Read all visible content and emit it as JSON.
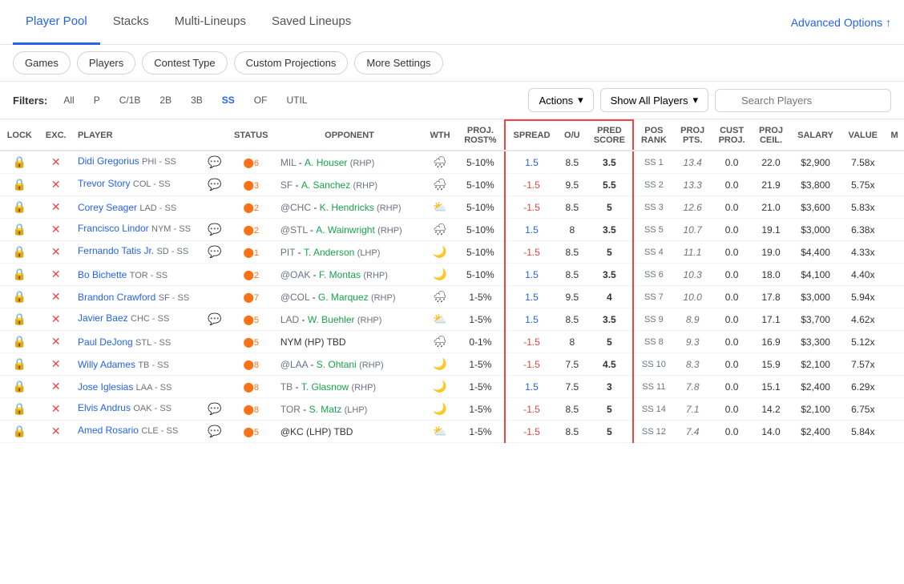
{
  "nav": {
    "links": [
      {
        "id": "player-pool",
        "label": "Player Pool",
        "active": true
      },
      {
        "id": "stacks",
        "label": "Stacks",
        "active": false
      },
      {
        "id": "multi-lineups",
        "label": "Multi-Lineups",
        "active": false
      },
      {
        "id": "saved-lineups",
        "label": "Saved Lineups",
        "active": false
      }
    ],
    "advanced_options": "Advanced Options ↑"
  },
  "filter_bar": {
    "buttons": [
      "Games",
      "Players",
      "Contest Type",
      "Custom Projections",
      "More Settings"
    ]
  },
  "table_controls": {
    "filters_label": "Filters:",
    "filter_tags": [
      "All",
      "P",
      "C/1B",
      "2B",
      "3B",
      "SS",
      "OF",
      "UTIL"
    ],
    "active_filter": "SS",
    "actions_label": "Actions",
    "show_players_label": "Show All Players",
    "search_placeholder": "Search Players"
  },
  "table": {
    "headers": [
      "LOCK",
      "EXC.",
      "PLAYER",
      "STATUS",
      "OPPONENT",
      "WTH",
      "PROJ. ROST%",
      "SPREAD",
      "O/U",
      "PRED SCORE",
      "POS RANK",
      "PROJ PTS.",
      "CUST PROJ.",
      "PROJ CEIL.",
      "SALARY",
      "VALUE",
      "M"
    ],
    "rows": [
      {
        "lock": true,
        "exc": true,
        "player": "Didi Gregorius",
        "team": "PHI",
        "pos": "SS",
        "status_num": "6",
        "opponent": "MIL - A. Houser",
        "opp_type": "RHP",
        "wth": "rain",
        "proj_rost": "5-10%",
        "spread": "1.5",
        "spread_pos": true,
        "ou": "8.5",
        "pred_score": "3.5",
        "pos_rank": "SS 1",
        "proj_pts": "13.4",
        "cust_proj": "0.0",
        "proj_ceil": "22.0",
        "salary": "$2,900",
        "value": "7.58x",
        "msg": true
      },
      {
        "lock": true,
        "exc": true,
        "player": "Trevor Story",
        "team": "COL",
        "pos": "SS",
        "status_num": "3",
        "opponent": "SF - A. Sanchez",
        "opp_type": "RHP",
        "wth": "rain",
        "proj_rost": "5-10%",
        "spread": "-1.5",
        "spread_pos": false,
        "ou": "9.5",
        "pred_score": "5.5",
        "pos_rank": "SS 2",
        "proj_pts": "13.3",
        "cust_proj": "0.0",
        "proj_ceil": "21.9",
        "salary": "$3,800",
        "value": "5.75x",
        "msg": true
      },
      {
        "lock": true,
        "exc": true,
        "player": "Corey Seager",
        "team": "LAD",
        "pos": "SS",
        "status_num": "2",
        "opponent": "@CHC - K. Hendricks",
        "opp_type": "RHP",
        "wth": "cloud",
        "proj_rost": "5-10%",
        "spread": "-1.5",
        "spread_pos": false,
        "ou": "8.5",
        "pred_score": "5",
        "pos_rank": "SS 3",
        "proj_pts": "12.6",
        "cust_proj": "0.0",
        "proj_ceil": "21.0",
        "salary": "$3,600",
        "value": "5.83x",
        "msg": false
      },
      {
        "lock": true,
        "exc": true,
        "player": "Francisco Lindor",
        "team": "NYM",
        "pos": "SS",
        "status_num": "2",
        "opponent": "@STL - A. Wainwright",
        "opp_type": "RHP",
        "wth": "rain",
        "proj_rost": "5-10%",
        "spread": "1.5",
        "spread_pos": true,
        "ou": "8",
        "pred_score": "3.5",
        "pos_rank": "SS 5",
        "proj_pts": "10.7",
        "cust_proj": "0.0",
        "proj_ceil": "19.1",
        "salary": "$3,000",
        "value": "6.38x",
        "msg": true
      },
      {
        "lock": true,
        "exc": true,
        "player": "Fernando Tatis Jr.",
        "team": "SD",
        "pos": "SS",
        "status_num": "1",
        "opponent": "PIT - T. Anderson",
        "opp_type": "LHP",
        "wth": "moon",
        "proj_rost": "5-10%",
        "spread": "-1.5",
        "spread_pos": false,
        "ou": "8.5",
        "pred_score": "5",
        "pos_rank": "SS 4",
        "proj_pts": "11.1",
        "cust_proj": "0.0",
        "proj_ceil": "19.0",
        "salary": "$4,400",
        "value": "4.33x",
        "msg": true
      },
      {
        "lock": true,
        "exc": true,
        "player": "Bo Bichette",
        "team": "TOR",
        "pos": "SS",
        "status_num": "2",
        "opponent": "@OAK - F. Montas",
        "opp_type": "RHP",
        "wth": "moon",
        "proj_rost": "5-10%",
        "spread": "1.5",
        "spread_pos": true,
        "ou": "8.5",
        "pred_score": "3.5",
        "pos_rank": "SS 6",
        "proj_pts": "10.3",
        "cust_proj": "0.0",
        "proj_ceil": "18.0",
        "salary": "$4,100",
        "value": "4.40x",
        "msg": false
      },
      {
        "lock": true,
        "exc": true,
        "player": "Brandon Crawford",
        "team": "SF",
        "pos": "SS",
        "status_num": "7",
        "opponent": "@COL - G. Marquez",
        "opp_type": "RHP",
        "wth": "rain",
        "proj_rost": "1-5%",
        "spread": "1.5",
        "spread_pos": true,
        "ou": "9.5",
        "pred_score": "4",
        "pos_rank": "SS 7",
        "proj_pts": "10.0",
        "cust_proj": "0.0",
        "proj_ceil": "17.8",
        "salary": "$3,000",
        "value": "5.94x",
        "msg": false
      },
      {
        "lock": true,
        "exc": true,
        "player": "Javier Baez",
        "team": "CHC",
        "pos": "SS",
        "status_num": "5",
        "opponent": "LAD - W. Buehler",
        "opp_type": "RHP",
        "wth": "cloud",
        "proj_rost": "1-5%",
        "spread": "1.5",
        "spread_pos": true,
        "ou": "8.5",
        "pred_score": "3.5",
        "pos_rank": "SS 9",
        "proj_pts": "8.9",
        "cust_proj": "0.0",
        "proj_ceil": "17.1",
        "salary": "$3,700",
        "value": "4.62x",
        "msg": true
      },
      {
        "lock": true,
        "exc": true,
        "player": "Paul DeJong",
        "team": "STL",
        "pos": "SS",
        "status_num": "5",
        "opponent": "NYM (HP) TBD",
        "opp_type": "",
        "wth": "rain",
        "proj_rost": "0-1%",
        "spread": "-1.5",
        "spread_pos": false,
        "ou": "8",
        "pred_score": "5",
        "pos_rank": "SS 8",
        "proj_pts": "9.3",
        "cust_proj": "0.0",
        "proj_ceil": "16.9",
        "salary": "$3,300",
        "value": "5.12x",
        "msg": false
      },
      {
        "lock": true,
        "exc": true,
        "player": "Willy Adames",
        "team": "TB",
        "pos": "SS",
        "status_num": "8",
        "opponent": "@LAA - S. Ohtani",
        "opp_type": "RHP",
        "wth": "moon",
        "proj_rost": "1-5%",
        "spread": "-1.5",
        "spread_pos": false,
        "ou": "7.5",
        "pred_score": "4.5",
        "pos_rank": "SS 10",
        "proj_pts": "8.3",
        "cust_proj": "0.0",
        "proj_ceil": "15.9",
        "salary": "$2,100",
        "value": "7.57x",
        "msg": false
      },
      {
        "lock": true,
        "exc": true,
        "player": "Jose Iglesias",
        "team": "LAA",
        "pos": "SS",
        "status_num": "8",
        "opponent": "TB - T. Glasnow",
        "opp_type": "RHP",
        "wth": "moon",
        "proj_rost": "1-5%",
        "spread": "1.5",
        "spread_pos": true,
        "ou": "7.5",
        "pred_score": "3",
        "pos_rank": "SS 11",
        "proj_pts": "7.8",
        "cust_proj": "0.0",
        "proj_ceil": "15.1",
        "salary": "$2,400",
        "value": "6.29x",
        "msg": false
      },
      {
        "lock": true,
        "exc": true,
        "player": "Elvis Andrus",
        "team": "OAK",
        "pos": "SS",
        "status_num": "8",
        "opponent": "TOR - S. Matz",
        "opp_type": "LHP",
        "wth": "moon",
        "proj_rost": "1-5%",
        "spread": "-1.5",
        "spread_pos": false,
        "ou": "8.5",
        "pred_score": "5",
        "pos_rank": "SS 14",
        "proj_pts": "7.1",
        "cust_proj": "0.0",
        "proj_ceil": "14.2",
        "salary": "$2,100",
        "value": "6.75x",
        "msg": true
      },
      {
        "lock": true,
        "exc": true,
        "player": "Amed Rosario",
        "team": "CLE",
        "pos": "SS",
        "status_num": "5",
        "opponent": "@KC (LHP) TBD",
        "opp_type": "",
        "wth": "cloud",
        "proj_rost": "1-5%",
        "spread": "-1.5",
        "spread_pos": false,
        "ou": "8.5",
        "pred_score": "5",
        "pos_rank": "SS 12",
        "proj_pts": "7.4",
        "cust_proj": "0.0",
        "proj_ceil": "14.0",
        "salary": "$2,400",
        "value": "5.84x",
        "msg": true
      }
    ]
  }
}
